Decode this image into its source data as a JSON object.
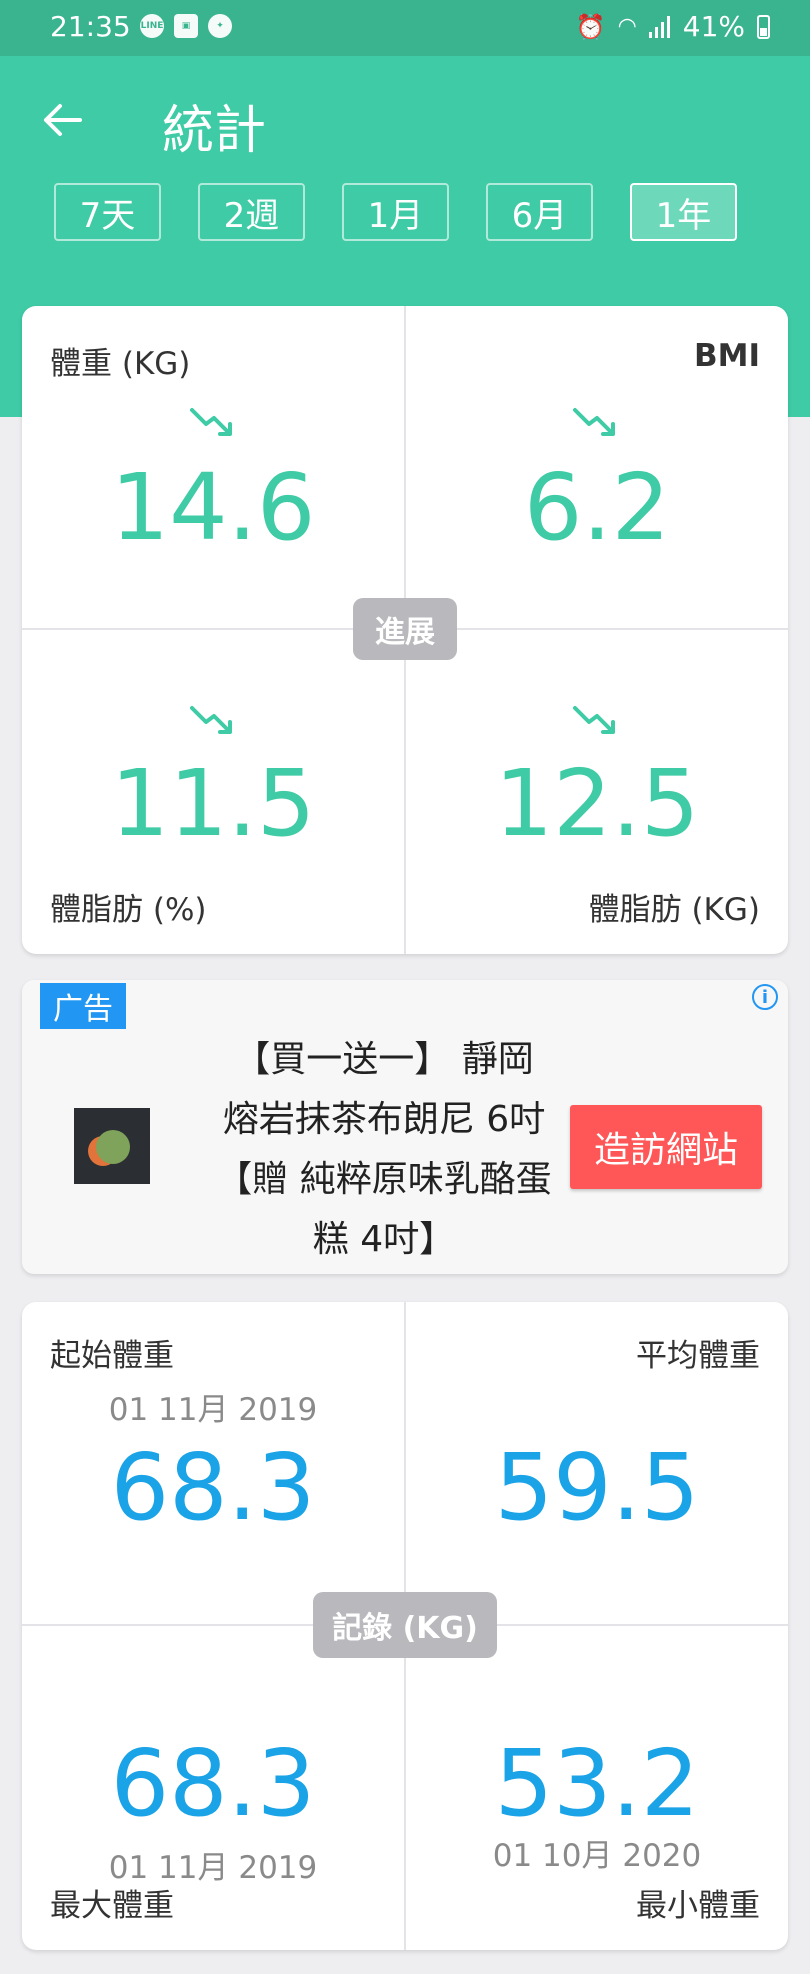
{
  "status_bar": {
    "time": "21:35",
    "battery": "41%",
    "left_icons": [
      "line-icon",
      "gallery-icon",
      "twitter-icon"
    ],
    "right_icons": [
      "alarm-icon",
      "wifi-icon",
      "signal-icon",
      "battery-icon"
    ]
  },
  "header": {
    "back_icon": "arrow-left-icon",
    "title": "統計",
    "ranges": [
      "7天",
      "2週",
      "1月",
      "6月",
      "1年"
    ],
    "active_range": "1年"
  },
  "progress": {
    "center_label": "進展",
    "weight": {
      "label": "體重 (KG)",
      "value": "14.6",
      "trend": "down"
    },
    "bmi": {
      "label": "BMI",
      "value": "6.2",
      "trend": "down"
    },
    "bodyfat_pct": {
      "label": "體脂肪 (%)",
      "value": "11.5",
      "trend": "down"
    },
    "bodyfat_kg": {
      "label": "體脂肪 (KG)",
      "value": "12.5",
      "trend": "down"
    }
  },
  "ad": {
    "tag": "广告",
    "text_lines": [
      "【買一送一】 靜岡",
      "熔岩抹茶布朗尼 6吋",
      "【贈 純粹原味乳酪蛋",
      "糕 4吋】"
    ],
    "button": "造訪網站",
    "info_icon": "info-icon"
  },
  "records": {
    "center_label": "記錄 (KG)",
    "start": {
      "label": "起始體重",
      "date": "01 11月 2019",
      "value": "68.3"
    },
    "average": {
      "label": "平均體重",
      "value": "59.5"
    },
    "max": {
      "label": "最大體重",
      "date": "01 11月 2019",
      "value": "68.3"
    },
    "min": {
      "label": "最小體重",
      "date": "01 10月 2020",
      "value": "53.2"
    }
  },
  "colors": {
    "primary": "#3ecba5",
    "status_bar": "#39b48f",
    "progress_value": "#3ecba5",
    "record_value": "#1aa3e6",
    "ad_button": "#ff5757",
    "ad_tag": "#2196f3"
  }
}
